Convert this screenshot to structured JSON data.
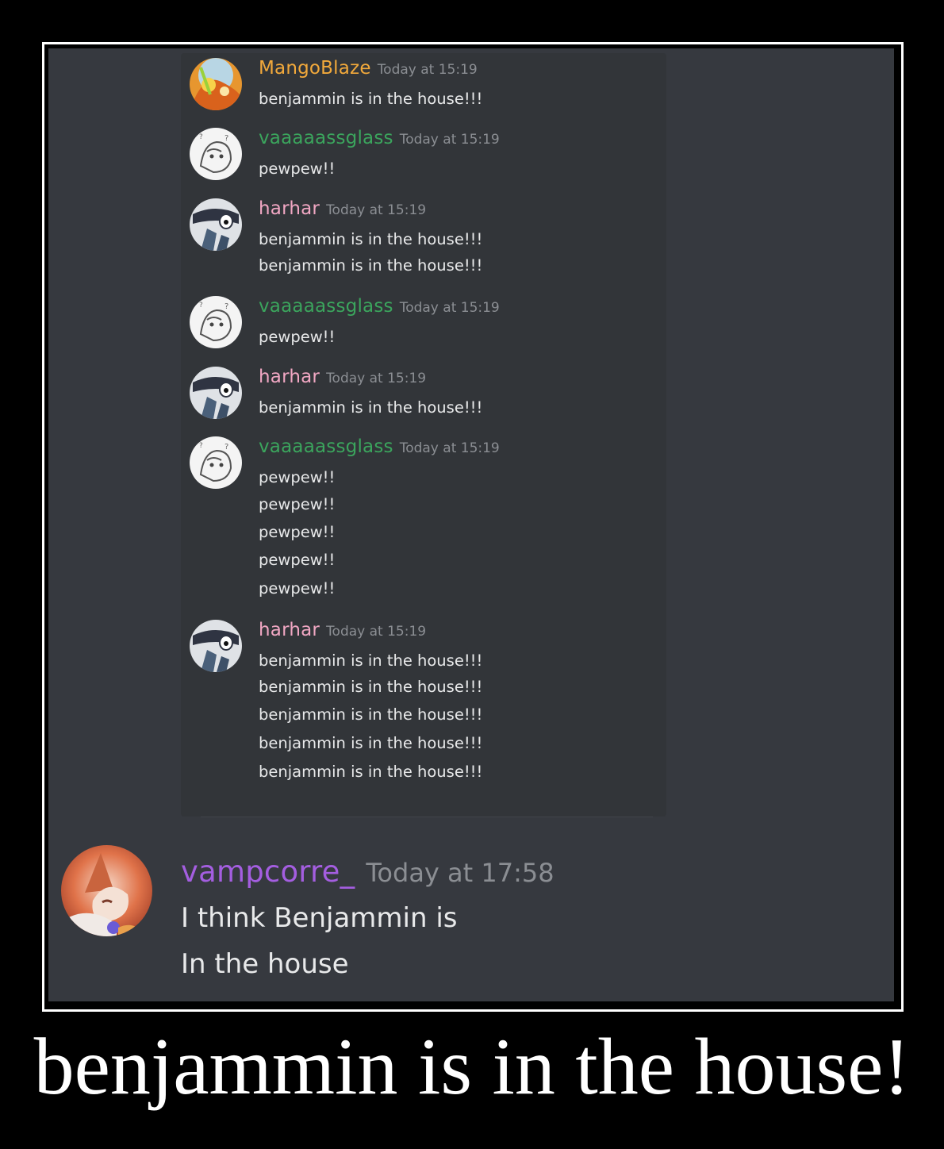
{
  "colors": {
    "page_bg": "#000000",
    "screen_bg": "#36393f",
    "message_text": "#e8e9ea",
    "timestamp": "#8b8e93",
    "mango_blaze": "#f2a93b",
    "vaaaaassglass": "#3ba55d",
    "harhar": "#f1a7c3",
    "vampcorre": "#a45ee0"
  },
  "quoted_messages": [
    {
      "username": "MangoBlaze",
      "timestamp": "Today at 15:19",
      "avatar": "orange-avatar-icon",
      "lines": [
        "benjammin is in the house!!!"
      ]
    },
    {
      "username": "vaaaaassglass",
      "timestamp": "Today at 15:19",
      "avatar": "sketch-avatar-icon",
      "lines": [
        "pewpew!!"
      ]
    },
    {
      "username": "harhar",
      "timestamp": "Today at 15:19",
      "avatar": "masked-avatar-icon",
      "lines": [
        "benjammin is in the house!!!",
        "benjammin is in the house!!!"
      ]
    },
    {
      "username": "vaaaaassglass",
      "timestamp": "Today at 15:19",
      "avatar": "sketch-avatar-icon",
      "lines": [
        "pewpew!!"
      ]
    },
    {
      "username": "harhar",
      "timestamp": "Today at 15:19",
      "avatar": "masked-avatar-icon",
      "lines": [
        "benjammin is in the house!!!"
      ]
    },
    {
      "username": "vaaaaassglass",
      "timestamp": "Today at 15:19",
      "avatar": "sketch-avatar-icon",
      "lines": [
        "pewpew!!",
        "pewpew!!",
        "pewpew!!",
        "pewpew!!",
        "pewpew!!"
      ]
    },
    {
      "username": "harhar",
      "timestamp": "Today at 15:19",
      "avatar": "masked-avatar-icon",
      "lines": [
        "benjammin is in the house!!!",
        "benjammin is in the house!!!",
        "benjammin is in the house!!!",
        "benjammin is in the house!!!",
        "benjammin is in the house!!!"
      ]
    }
  ],
  "reply_message": {
    "username": "vampcorre_",
    "timestamp": "Today at 17:58",
    "avatar": "fox-avatar-icon",
    "lines": [
      "I think Benjammin is",
      "In the house"
    ]
  },
  "caption": "benjammin is in the house!"
}
